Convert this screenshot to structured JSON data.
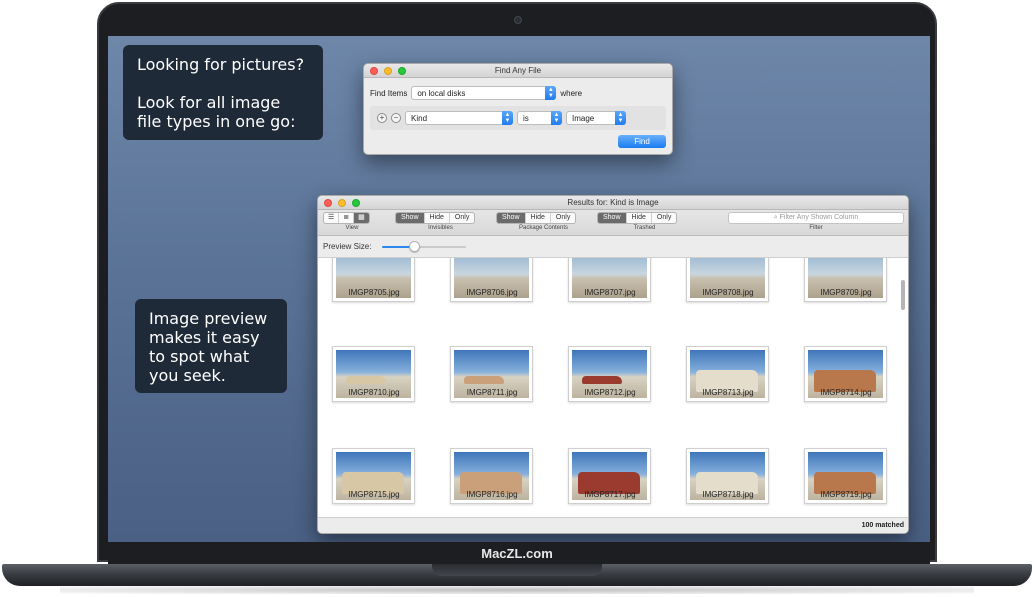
{
  "brand": "MacZL.com",
  "callouts": {
    "first_line1": "Looking for pictures?",
    "first_line2": "Look for all image file types in one go:",
    "second": "Image preview makes it easy to spot what you seek."
  },
  "find_window": {
    "title": "Find Any File",
    "find_items_label": "Find Items",
    "location_value": "on local disks",
    "where_label": "where",
    "criterion": {
      "field": "Kind",
      "operator": "is",
      "value": "Image"
    },
    "find_button": "Find"
  },
  "results_window": {
    "title": "Results for: Kind is Image",
    "toolbar": {
      "view_label": "View",
      "invisibles": {
        "label": "Invisibles",
        "options": [
          "Show",
          "Hide",
          "Only"
        ],
        "selected": "Show"
      },
      "package_contents": {
        "label": "Package Contents",
        "options": [
          "Show",
          "Hide",
          "Only"
        ],
        "selected": "Show"
      },
      "trashed": {
        "label": "Trashed",
        "options": [
          "Show",
          "Hide",
          "Only"
        ],
        "selected": "Show"
      },
      "filter_placeholder": "Filter Any Shown Column",
      "filter_label": "Filter"
    },
    "preview_size_label": "Preview Size:",
    "preview_size": 0.35,
    "files": [
      "IMGP8705.jpg",
      "IMGP8706.jpg",
      "IMGP8707.jpg",
      "IMGP8708.jpg",
      "IMGP8709.jpg",
      "IMGP8710.jpg",
      "IMGP8711.jpg",
      "IMGP8712.jpg",
      "IMGP8713.jpg",
      "IMGP8714.jpg",
      "IMGP8715.jpg",
      "IMGP8716.jpg",
      "IMGP8717.jpg",
      "IMGP8718.jpg",
      "IMGP8719.jpg"
    ],
    "status": "100 matched"
  }
}
